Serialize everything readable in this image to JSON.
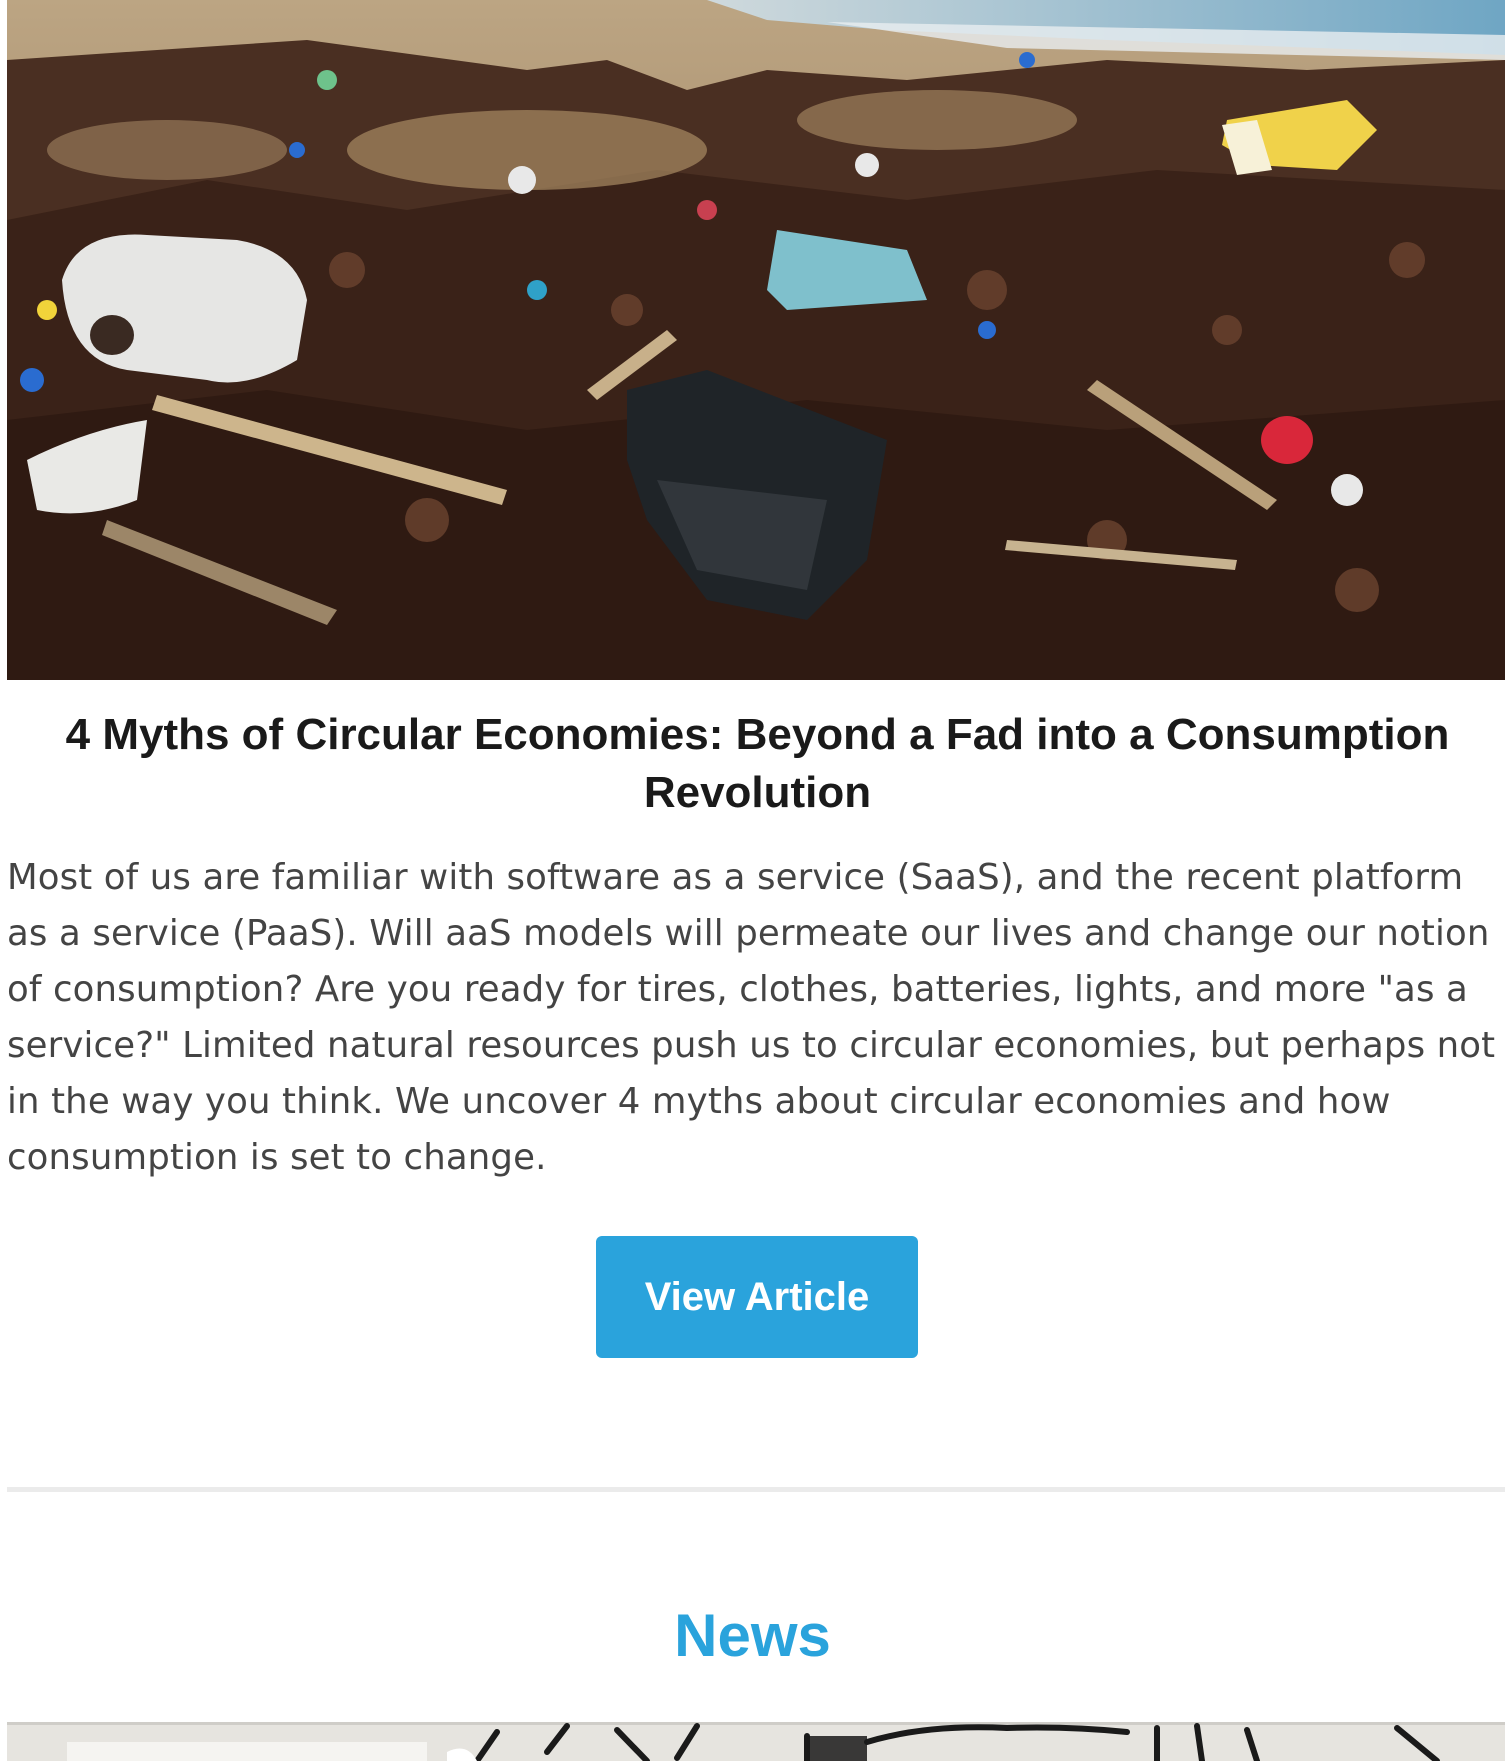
{
  "article": {
    "image_alt": "Plastic debris and seaweed on a beach",
    "title": "4 Myths of Circular Economies: Beyond a Fad into a Consumption Revolution",
    "body": "Most of us are familiar with software as a service (SaaS), and the recent platform as a service (PaaS).  Will aaS models will permeate our lives and change our notion of consumption? Are you ready for tires, clothes, batteries, lights, and more \"as a service?\" Limited natural resources push us to circular economies, but perhaps not in the way you think. We uncover 4 myths about circular economies and how consumption is set to change.",
    "button_label": "View Article"
  },
  "news": {
    "heading": "News"
  },
  "colors": {
    "accent": "#2aa3dc",
    "title_text": "#1a1a1a",
    "body_text": "#444444",
    "divider": "#ebebeb"
  }
}
